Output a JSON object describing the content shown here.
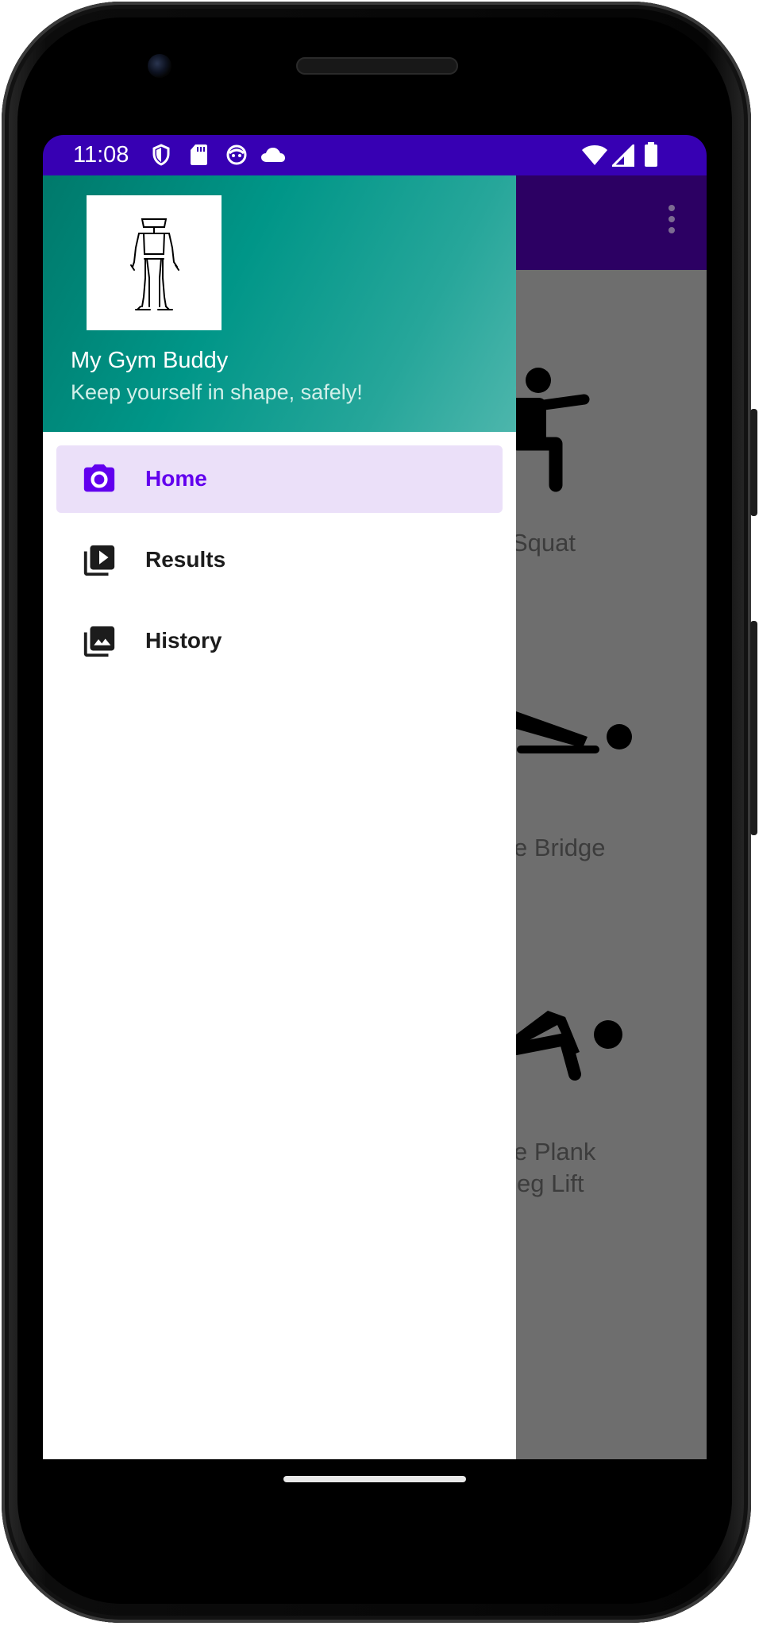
{
  "status_bar": {
    "time": "11:08",
    "background": "#3700b3",
    "left_icons": [
      "shield-icon",
      "sd-card-icon",
      "face-icon",
      "cloud-icon"
    ],
    "right_icons": [
      "wifi-icon",
      "cellular-signal-icon",
      "battery-icon"
    ]
  },
  "drawer": {
    "header": {
      "title": "My Gym Buddy",
      "subtitle": "Keep yourself in shape, safely!",
      "avatar": "stick-figure-icon",
      "gradient": [
        "#00796b",
        "#4db6ac"
      ]
    },
    "items": [
      {
        "label": "Home",
        "icon": "camera-icon",
        "active": true
      },
      {
        "label": "Results",
        "icon": "video-library-icon",
        "active": false
      },
      {
        "label": "History",
        "icon": "photo-library-icon",
        "active": false
      }
    ],
    "active_color": "#6200ee",
    "active_background": "#ebe0f9"
  },
  "background_app": {
    "toolbar_color": "#2c0063",
    "menu_icon": "overflow-menu-icon",
    "exercises": [
      {
        "label": "Squat",
        "icon": "squat-icon"
      },
      {
        "label": "e Bridge",
        "icon": "bridge-icon"
      },
      {
        "label_line1": "e Plank",
        "label_line2": "eg Lift",
        "icon": "plank-icon"
      }
    ]
  }
}
